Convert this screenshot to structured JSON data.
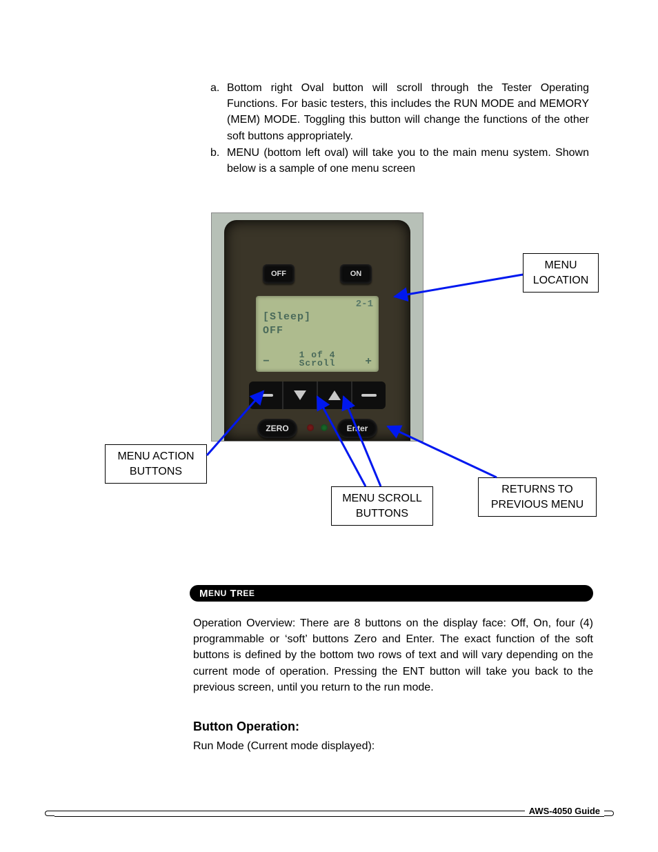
{
  "list": {
    "a_marker": "a.",
    "a_text": "Bottom right Oval button will scroll through the Tester Operating Functions.  For basic testers, this includes the RUN MODE and MEMORY (MEM) MODE.  Toggling this button will change the functions of the other soft buttons appropriately.",
    "b_marker": "b.",
    "b_text": "MENU (bottom left oval) will take you to the main menu system. Shown below is a sample of one menu screen"
  },
  "device": {
    "off_label": "OFF",
    "on_label": "ON",
    "lcd": {
      "topright": "2-1",
      "line1": "[Sleep]",
      "line2": "OFF",
      "center1": "1 of 4",
      "center2": "Scroll",
      "minus": "−",
      "plus": "+"
    },
    "zero_label": "ZERO",
    "enter_label": "Enter"
  },
  "callouts": {
    "menu_location": "MENU LOCATION",
    "menu_action": "MENU ACTION BUTTONS",
    "menu_scroll": "MENU SCROLL BUTTONS",
    "returns": "RETURNS TO PREVIOUS MENU"
  },
  "headings": {
    "menu_tree_M": "M",
    "menu_tree_enu": "ENU",
    "menu_tree_T": " T",
    "menu_tree_ree": "REE",
    "button_operation": "Button Operation:"
  },
  "paragraphs": {
    "overview": " Operation Overview: There are 8 buttons on the display face: Off, On, four (4) programmable or ‘soft’ buttons Zero and Enter.  The exact function of the soft buttons is defined by the bottom two rows of text and will vary depending on the current mode of operation. Pressing the ENT button will take you back to the previous screen, until you return to the run mode.",
    "run_mode": "Run Mode (Current mode displayed):"
  },
  "footer": {
    "guide": "AWS-4050 Guide"
  }
}
